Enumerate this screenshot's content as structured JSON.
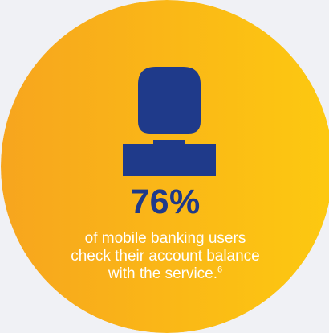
{
  "colors": {
    "page_background": "#f0f1f5",
    "circle_gradient_left": "#f7a51e",
    "circle_gradient_right": "#fdc910",
    "icon": "#1f3a8a",
    "value_text": "#1f3a8a",
    "description_text": "#ffffff"
  },
  "icon": "person-silhouette-icon",
  "stat": {
    "value": "76%",
    "description_lines": [
      "of mobile banking users",
      "check their account balance",
      "with the service."
    ],
    "footnote": "6"
  }
}
